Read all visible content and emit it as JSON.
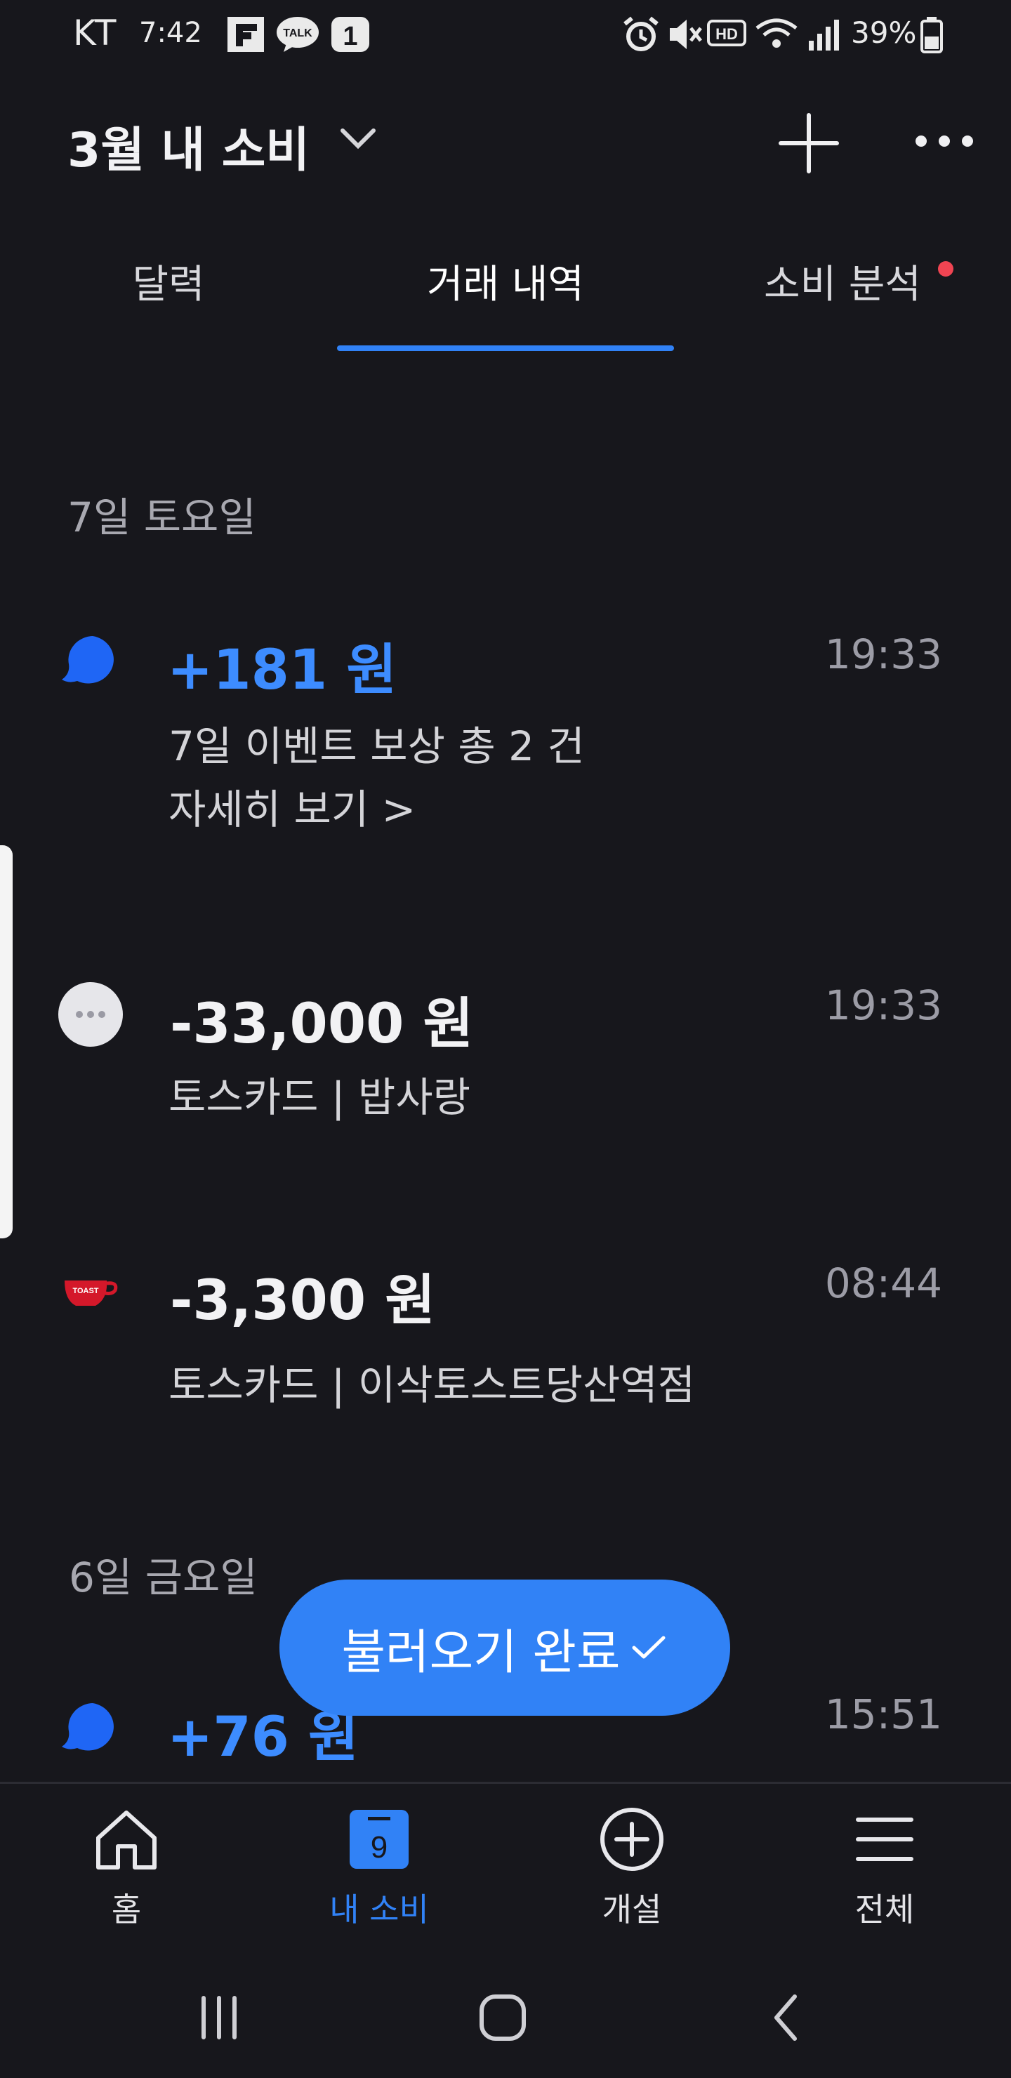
{
  "status_bar": {
    "carrier": "KT",
    "time": "7:42",
    "battery": "39%"
  },
  "header": {
    "title": "3월 내 소비"
  },
  "tabs": [
    {
      "label": "달력"
    },
    {
      "label": "거래 내역"
    },
    {
      "label": "소비 분석"
    }
  ],
  "sections": [
    {
      "date": "7일 토요일",
      "transactions": [
        {
          "amount": "+181 원",
          "desc1": "7일 이벤트 보상 총 2 건",
          "desc2": "자세히 보기 >",
          "time": "19:33"
        },
        {
          "amount": "-33,000 원",
          "desc1": "토스카드 | 밥사랑",
          "time": "19:33"
        },
        {
          "amount": "-3,300 원",
          "desc1": "토스카드 | 이삭토스트당산역점",
          "time": "08:44"
        }
      ]
    },
    {
      "date": "6일 금요일",
      "transactions": [
        {
          "amount": "+76 원",
          "time": "15:51"
        }
      ]
    }
  ],
  "toast": {
    "label": "불러오기 완료"
  },
  "bottom_nav": [
    {
      "label": "홈",
      "icon": "home-icon"
    },
    {
      "label": "내 소비",
      "icon": "calendar-icon",
      "badge": "9"
    },
    {
      "label": "개설",
      "icon": "plus-circle-icon"
    },
    {
      "label": "전체",
      "icon": "menu-icon"
    }
  ],
  "colors": {
    "accent": "#3182f6",
    "background": "#17171c",
    "notification_dot": "#f04452"
  }
}
